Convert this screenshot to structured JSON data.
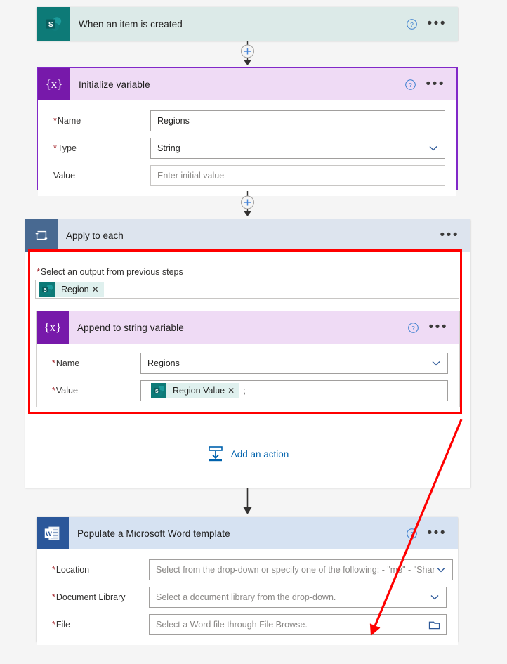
{
  "flow": {
    "trigger": {
      "title": "When an item is created",
      "icon": "sharepoint-icon",
      "help_label": "?",
      "more_label": "•••"
    },
    "init_variable": {
      "title": "Initialize variable",
      "icon": "variable-icon",
      "fields": [
        {
          "label": "Name",
          "required": true,
          "value": "Regions",
          "placeholder": "",
          "control": "text"
        },
        {
          "label": "Type",
          "required": true,
          "value": "String",
          "placeholder": "",
          "control": "dropdown"
        },
        {
          "label": "Value",
          "required": false,
          "value": "",
          "placeholder": "Enter initial value",
          "control": "text"
        }
      ]
    },
    "apply_to_each": {
      "title": "Apply to each",
      "icon": "loop-icon",
      "output_label": "Select an output from previous steps",
      "output_required": true,
      "output_token": {
        "label": "Region",
        "icon": "sharepoint-icon",
        "remove": "✕"
      },
      "append_action": {
        "title": "Append to string variable",
        "icon": "variable-icon",
        "fields": [
          {
            "label": "Name",
            "required": true,
            "value": "Regions",
            "control": "dropdown"
          },
          {
            "label": "Value",
            "required": true,
            "control": "token",
            "token": {
              "label": "Region Value",
              "icon": "sharepoint-icon",
              "remove": "✕"
            },
            "trailing_text": ";"
          }
        ]
      },
      "add_action": {
        "label": "Add an action",
        "icon": "insert-action-icon"
      }
    },
    "word_template": {
      "title": "Populate a Microsoft Word template",
      "icon": "word-icon",
      "fields": [
        {
          "label": "Location",
          "required": true,
          "placeholder": "Select from the drop-down or specify one of the following: - \"me\" - \"Shar",
          "control": "dropdown"
        },
        {
          "label": "Document Library",
          "required": true,
          "placeholder": "Select a document library from the drop-down.",
          "control": "dropdown"
        },
        {
          "label": "File",
          "required": true,
          "placeholder": "Select a Word file through File Browse.",
          "control": "filebrowse"
        }
      ]
    },
    "connectors": [
      {
        "name": "connector-trigger-to-init",
        "has_plus": true
      },
      {
        "name": "connector-init-to-loop",
        "has_plus": true
      },
      {
        "name": "connector-loop-to-word",
        "has_plus": false
      }
    ],
    "annotations": {
      "highlight_box": {
        "color": "#ff0000",
        "target": "apply-to-each-contents"
      },
      "arrow": {
        "color": "#ff0000",
        "from": "loop-bottom-right",
        "to": "word-file-field"
      }
    }
  },
  "colors": {
    "trigger_header": "#dceae8",
    "variable_header": "#efdbf5",
    "variable_icon": "#7719aa",
    "loop_header": "#dde4ee",
    "loop_icon": "#486991",
    "word_header": "#d6e2f2",
    "word_icon": "#2b579a",
    "sharepoint_icon": "#0d7a77",
    "link": "#0062ad",
    "required": "#a4262c",
    "annotation": "#ff0000"
  }
}
